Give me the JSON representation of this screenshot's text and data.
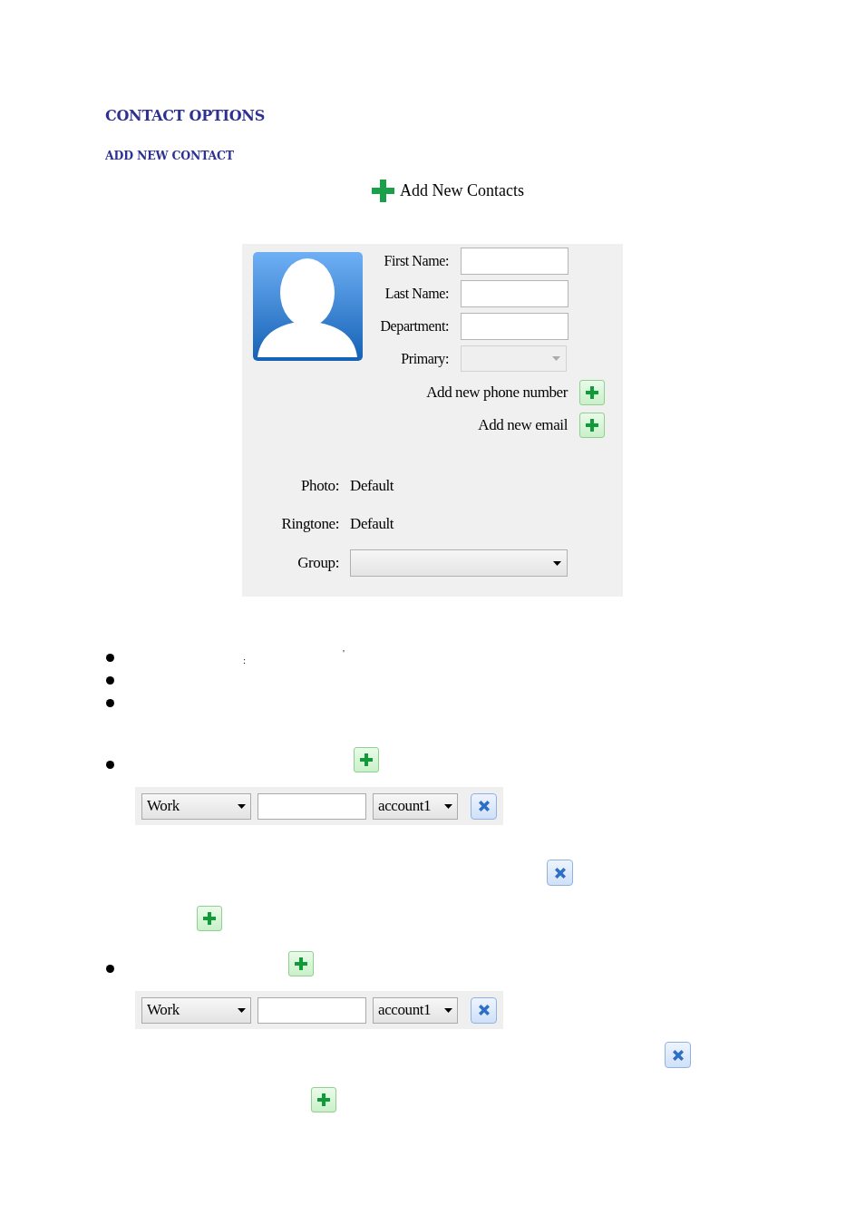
{
  "headings": [
    "CONTACT OPTIONS",
    "ADD NEW CONTACT"
  ],
  "add_link": "Add New Contacts",
  "form": {
    "fields": [
      {
        "label": "First Name:",
        "kind": "text"
      },
      {
        "label": "Last Name:",
        "kind": "text"
      },
      {
        "label": "Department:",
        "kind": "text"
      },
      {
        "label": "Primary:",
        "kind": "select",
        "disabled": true
      }
    ],
    "actions": [
      "Add new phone number",
      "Add new email"
    ],
    "info": [
      {
        "label": "Photo:",
        "value": "Default"
      },
      {
        "label": "Ringtone:",
        "value": "Default"
      }
    ],
    "group": {
      "label": "Group:"
    }
  },
  "list": [
    {
      "kind": "bullet",
      "marks": [
        ":",
        "'"
      ]
    },
    {
      "kind": "bullet"
    },
    {
      "kind": "bullet"
    },
    {
      "kind": "bullet-add"
    },
    {
      "kind": "entry",
      "type": "Work",
      "account": "account1"
    },
    {
      "kind": "remove"
    },
    {
      "kind": "add"
    },
    {
      "kind": "bullet-add"
    },
    {
      "kind": "entry",
      "type": "Work",
      "account": "account1"
    },
    {
      "kind": "remove"
    },
    {
      "kind": "add"
    }
  ]
}
